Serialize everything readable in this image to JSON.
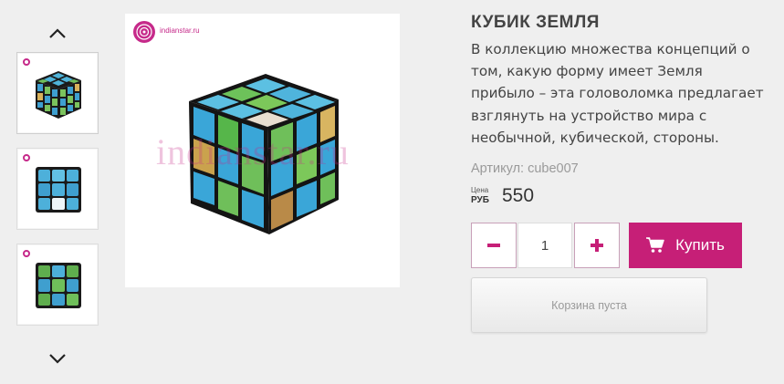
{
  "gallery": {
    "brand_text": "indianstar.ru",
    "watermark": "indianstar.ru",
    "thumbnails": [
      {
        "name": "thumb-1"
      },
      {
        "name": "thumb-2"
      },
      {
        "name": "thumb-3"
      }
    ],
    "up_icon": "chevron-up-icon",
    "down_icon": "chevron-down-icon"
  },
  "product": {
    "title": "КУБИК ЗЕМЛЯ",
    "description": "В коллекцию множества концепций о том, какую форму имеет Земля прибыло – эта головоломка предлагает взглянуть на устройство мира с необычной, кубической, стороны.",
    "sku": "Артикул: cube007",
    "price_label": "Цена",
    "currency": "РУБ",
    "price": "550"
  },
  "purchase": {
    "quantity": "1",
    "buy_label": "Купить",
    "cart_label": "Корзина пуста"
  },
  "colors": {
    "accent": "#c61f77",
    "background": "#efefef"
  }
}
